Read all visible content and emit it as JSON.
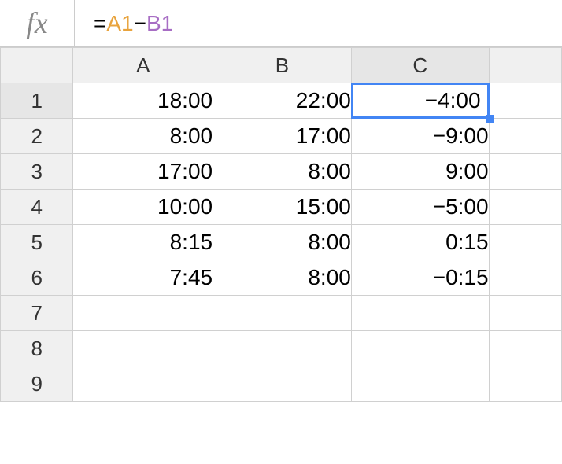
{
  "formula": {
    "eq": "=",
    "refA": "A1",
    "minus": "−",
    "refB": "B1",
    "fx": "fx"
  },
  "headers": {
    "cols": [
      "A",
      "B",
      "C"
    ],
    "rows": [
      "1",
      "2",
      "3",
      "4",
      "5",
      "6",
      "7",
      "8",
      "9"
    ]
  },
  "data": [
    {
      "a": "18:00",
      "b": "22:00",
      "c": "−4:00"
    },
    {
      "a": "8:00",
      "b": "17:00",
      "c": "−9:00"
    },
    {
      "a": "17:00",
      "b": "8:00",
      "c": "9:00"
    },
    {
      "a": "10:00",
      "b": "15:00",
      "c": "−5:00"
    },
    {
      "a": "8:15",
      "b": "8:00",
      "c": "0:15"
    },
    {
      "a": "7:45",
      "b": "8:00",
      "c": "−0:15"
    },
    {
      "a": "",
      "b": "",
      "c": ""
    },
    {
      "a": "",
      "b": "",
      "c": ""
    },
    {
      "a": "",
      "b": "",
      "c": ""
    }
  ],
  "selected": {
    "row": 0,
    "col": "c"
  }
}
